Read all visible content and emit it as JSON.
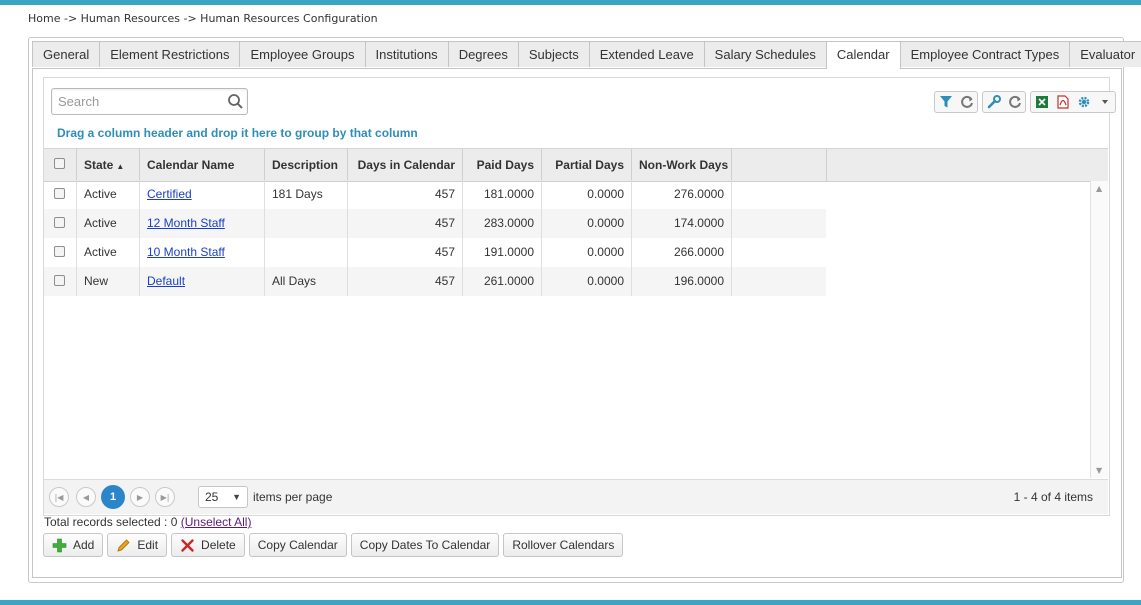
{
  "breadcrumb": "Home -> Human Resources -> Human Resources Configuration",
  "tabs": [
    {
      "label": "General",
      "active": false
    },
    {
      "label": "Element Restrictions",
      "active": false
    },
    {
      "label": "Employee Groups",
      "active": false
    },
    {
      "label": "Institutions",
      "active": false
    },
    {
      "label": "Degrees",
      "active": false
    },
    {
      "label": "Subjects",
      "active": false
    },
    {
      "label": "Extended Leave",
      "active": false
    },
    {
      "label": "Salary Schedules",
      "active": false
    },
    {
      "label": "Calendar",
      "active": true
    },
    {
      "label": "Employee Contract Types",
      "active": false
    },
    {
      "label": "Evaluator",
      "active": false
    }
  ],
  "search": {
    "placeholder": "Search",
    "value": ""
  },
  "group_hint": "Drag a column header and drop it here to group by that column",
  "toolbar_icons": [
    "filter-icon",
    "refresh-icon",
    "wrench-icon",
    "refresh-icon",
    "excel-icon",
    "pdf-icon",
    "gear-icon",
    "caret-down-icon"
  ],
  "columns": {
    "state": "State",
    "state_sort": "▲",
    "name": "Calendar Name",
    "description": "Description",
    "days": "Days in Calendar",
    "paid": "Paid Days",
    "partial": "Partial Days",
    "nonwork": "Non-Work Days"
  },
  "rows": [
    {
      "state": "Active",
      "name": "Certified",
      "description": "181 Days",
      "days": "457",
      "paid": "181.0000",
      "partial": "0.0000",
      "nonwork": "276.0000"
    },
    {
      "state": "Active",
      "name": "12 Month Staff",
      "description": "",
      "days": "457",
      "paid": "283.0000",
      "partial": "0.0000",
      "nonwork": "174.0000"
    },
    {
      "state": "Active",
      "name": "10 Month Staff",
      "description": "",
      "days": "457",
      "paid": "191.0000",
      "partial": "0.0000",
      "nonwork": "266.0000"
    },
    {
      "state": "New",
      "name": "Default",
      "description": "All Days",
      "days": "457",
      "paid": "261.0000",
      "partial": "0.0000",
      "nonwork": "196.0000"
    }
  ],
  "pager": {
    "current_page": "1",
    "page_size": "25",
    "per_page_label": "items per page",
    "info": "1 - 4 of 4 items"
  },
  "selection": {
    "label": "Total records selected : 0",
    "unselect": "(Unselect All)"
  },
  "actions": {
    "add": "Add",
    "edit": "Edit",
    "delete": "Delete",
    "copy_calendar": "Copy Calendar",
    "copy_dates": "Copy Dates To Calendar",
    "rollover": "Rollover Calendars"
  },
  "colors": {
    "accent": "#3aa6c4",
    "link": "#1a3fc7",
    "hint": "#2e8eb8",
    "page_active": "#2a86c9"
  }
}
